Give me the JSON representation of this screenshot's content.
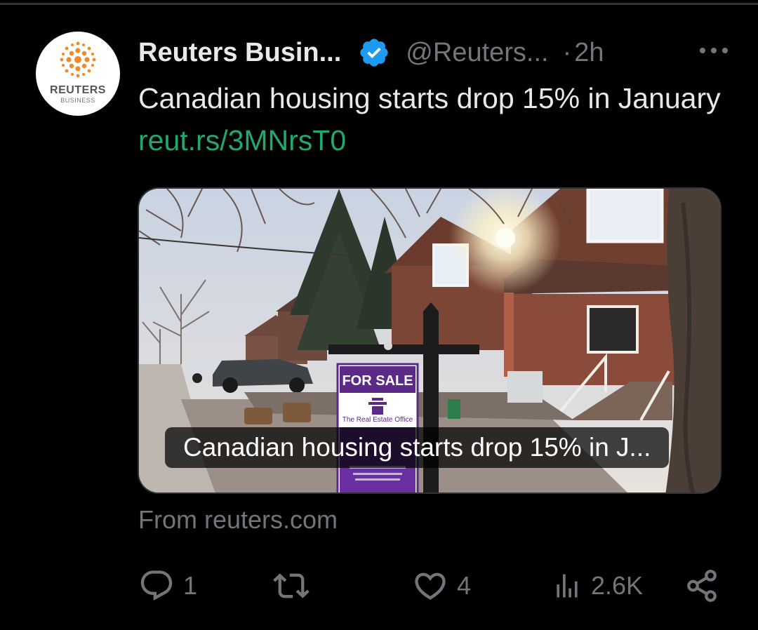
{
  "author": {
    "display_name": "Reuters Busin...",
    "handle": "@Reuters...",
    "separator": "·",
    "time": "2h",
    "avatar_brand": "REUTERS",
    "avatar_sub": "BUSINESS"
  },
  "tweet": {
    "text_part1": "Canadian housing starts drop 15% in January ",
    "link": "reut.rs/3MNrsT0"
  },
  "card": {
    "caption": "Canadian housing starts drop 15% in J...",
    "sign_text": "FOR SALE",
    "sign_company": "The Real Estate Office",
    "source": "From reuters.com"
  },
  "actions": {
    "reply_count": "1",
    "retweet_count": "",
    "like_count": "4",
    "views_count": "2.6K"
  },
  "colors": {
    "link": "#21a96c",
    "verified": "#1d9bf0",
    "muted": "#71767b",
    "text": "#e7e9ea",
    "background": "#000000"
  },
  "icons": [
    "verified-badge-icon",
    "more-icon",
    "reply-icon",
    "retweet-icon",
    "like-icon",
    "views-icon",
    "share-icon"
  ]
}
